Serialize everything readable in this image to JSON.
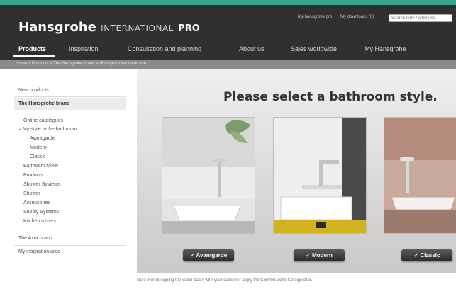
{
  "header": {
    "brand": "Hansgrohe",
    "brand_sub": "INTERNATIONAL",
    "brand_pro": "PRO",
    "links": [
      "My hansgrohe pro",
      "My downloads (0)"
    ],
    "search_value": "Search term / article no."
  },
  "nav": [
    {
      "label": "Products",
      "active": true
    },
    {
      "label": "Inspiration",
      "active": false
    },
    {
      "label": "Consultation and planning",
      "active": false
    },
    {
      "label": "About us",
      "active": false
    },
    {
      "label": "Sales worldwide",
      "active": false
    },
    {
      "label": "My Hansgrohe",
      "active": false
    }
  ],
  "breadcrumb": "Home > Products > The Hansgrohe brand > My style in the bathroom",
  "sidebar": {
    "items": [
      "New products",
      "The Hansgrohe brand",
      "Online catalogues",
      "> My style in the bathroom",
      "Avantgarde",
      "Modern",
      "Classic",
      "Bathroom Mixer",
      "Products",
      "Shower Systems",
      "Shower",
      "Accessories",
      "Supply Systems",
      "Kitchen mixers",
      "The Axor brand",
      "My inspiration area"
    ]
  },
  "main": {
    "headline": "Please select a bathroom style.",
    "styles": [
      {
        "label": "✓ Avantgarde"
      },
      {
        "label": "✓ Modern"
      },
      {
        "label": "✓ Classic"
      }
    ],
    "footnote": "Note: For designing the water basin with your customer apply the Comfort Zone Configurator."
  },
  "colors": {
    "header_bg": "#303030",
    "accent_strip": "#3aa58a",
    "basin_yellow": "#d2b21e"
  }
}
